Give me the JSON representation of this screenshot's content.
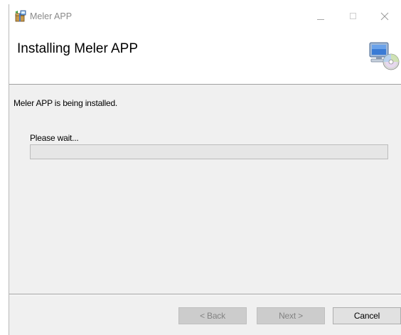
{
  "window": {
    "title": "Meler APP",
    "icon": "installer-package-icon"
  },
  "titlebar": {
    "minimize_glyph": "minimize-icon",
    "maximize_glyph": "maximize-icon",
    "close_glyph": "close-icon"
  },
  "banner": {
    "heading": "Installing Meler APP",
    "icon": "computer-cd-icon"
  },
  "main": {
    "status_text": "Meler APP is being installed.",
    "wait_label": "Please wait...",
    "progress_fraction": 0.0
  },
  "footer": {
    "back_label": "< Back",
    "next_label": "Next >",
    "cancel_label": "Cancel"
  }
}
